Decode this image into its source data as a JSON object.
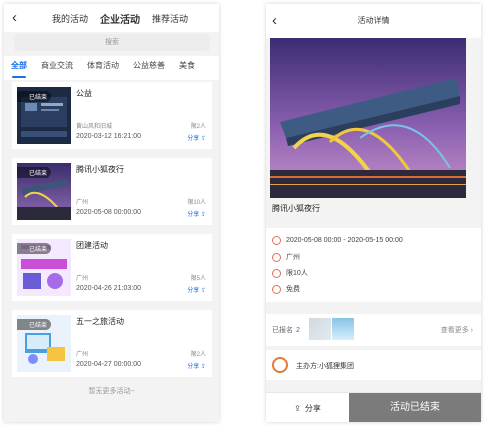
{
  "left": {
    "tabs": [
      "我的活动",
      "企业活动",
      "推荐活动"
    ],
    "active_tab": "企业活动",
    "search_placeholder": "搜索",
    "categories": [
      "全部",
      "商业交流",
      "体育活动",
      "公益慈善",
      "美食"
    ],
    "cards": [
      {
        "badge": "已结束",
        "title": "公益",
        "location": "黄山风和旧城",
        "people": "限2人",
        "date": "2020-03-12 16:21:00",
        "share": "分享"
      },
      {
        "badge": "已结束",
        "title": "腾讯小狐夜行",
        "location": "广州",
        "people": "限10人",
        "date": "2020-05-08 00:00:00",
        "share": "分享"
      },
      {
        "badge": "已结束",
        "title": "团建活动",
        "location": "广州",
        "people": "限5人",
        "date": "2020-04-26 21:03:00",
        "share": "分享"
      },
      {
        "badge": "已结束",
        "title": "五一之旅活动",
        "location": "广州",
        "people": "限2人",
        "date": "2020-04-27 00:00:00",
        "share": "分享"
      }
    ],
    "footer": "暂无更多活动~"
  },
  "right": {
    "title": "活动详情",
    "activity_name": "腾讯小狐夜行",
    "time": "2020-05-08 00:00 - 2020-05-15 00:00",
    "location": "广州",
    "limit": "限10人",
    "fee": "免费",
    "registered_label": "已报名",
    "registered_count": "2",
    "see_more": "查看更多",
    "organizer": "主办方:小狐狸集团",
    "share_label": "分享",
    "ended_label": "活动已结束"
  },
  "colors": {
    "accent": "#1f6feb",
    "ended": "#7b7b7b"
  }
}
